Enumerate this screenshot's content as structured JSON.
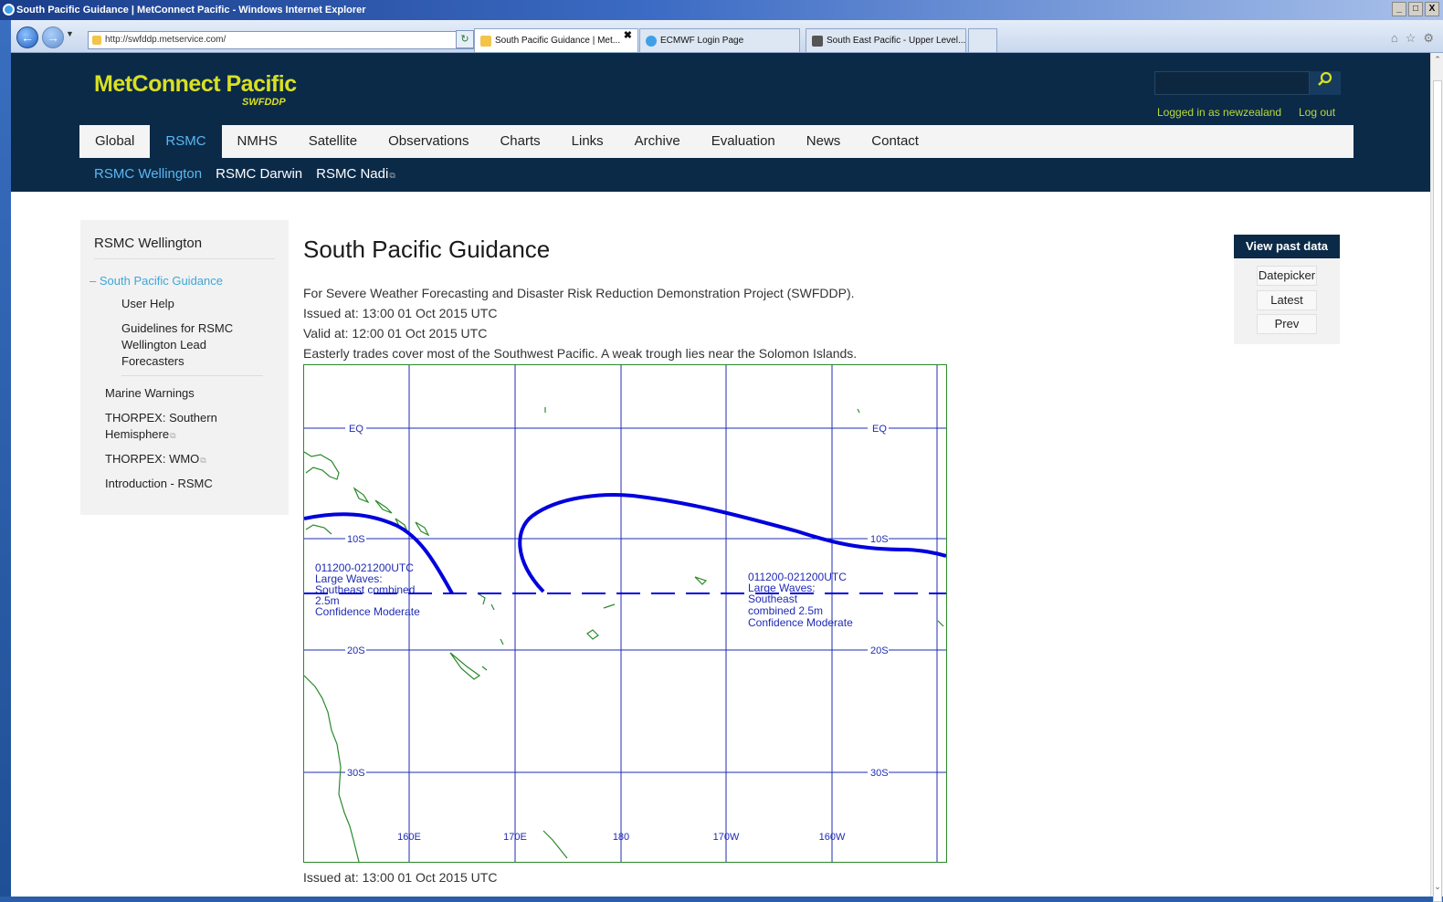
{
  "window": {
    "title": "South Pacific Guidance | MetConnect Pacific - Windows Internet Explorer",
    "controls": [
      "_",
      "□",
      "X"
    ]
  },
  "browser": {
    "address": "http://swfddp.metservice.com/",
    "tabs": [
      {
        "label": "South Pacific Guidance | Met...",
        "active": true,
        "icon_color": "#f3c44a"
      },
      {
        "label": "ECMWF Login Page",
        "active": false,
        "icon_color": "#3fa0e8"
      },
      {
        "label": "South East Pacific - Upper Level...",
        "active": false,
        "icon_color": "#555555"
      }
    ],
    "tab_close": "✖"
  },
  "site": {
    "logo": "MetConnect Pacific",
    "logo_sub": "SWFDDP",
    "search_icon": "search-icon",
    "logged_in": "Logged in as newzealand",
    "logout": "Log out",
    "brand_color": "#0b2a48",
    "accent_color": "#d9e021"
  },
  "nav": {
    "items": [
      "Global",
      "RSMC",
      "NMHS",
      "Satellite",
      "Observations",
      "Charts",
      "Links",
      "Archive",
      "Evaluation",
      "News",
      "Contact"
    ],
    "active": "RSMC"
  },
  "subnav": {
    "items": [
      "RSMC Wellington",
      "RSMC Darwin",
      "RSMC Nadi"
    ],
    "active": "RSMC Wellington"
  },
  "sidebar": {
    "title": "RSMC Wellington",
    "current": "South Pacific Guidance",
    "current_marker": "–",
    "sub_items": [
      "User Help",
      "Guidelines for RSMC",
      "Wellington Lead",
      "Forecasters"
    ],
    "links": [
      "Marine Warnings",
      "THORPEX: Southern",
      "Hemisphere",
      "THORPEX: WMO",
      "Introduction - RSMC"
    ]
  },
  "main": {
    "title": "South Pacific Guidance",
    "desc": "For Severe Weather Forecasting and Disaster Risk Reduction Demonstration Project (SWFDDP).",
    "issued": "Issued at: 13:00 01 Oct 2015 UTC",
    "valid": "Valid at: 12:00 01 Oct 2015 UTC",
    "summary": "Easterly trades cover most of the Southwest Pacific. A weak trough lies near the Solomon Islands.",
    "footer_issued": "Issued at: 13:00 01 Oct 2015 UTC"
  },
  "past_data": {
    "header": "View past data",
    "buttons": [
      "Datepicker",
      "Latest",
      "Prev"
    ]
  },
  "map": {
    "lat_labels": [
      "EQ",
      "10S",
      "20S",
      "30S"
    ],
    "lon_labels": [
      "160E",
      "170E",
      "180",
      "170W",
      "160W"
    ],
    "annotations": [
      [
        "011200-021200UTC",
        "Large Waves:",
        "Southeast combined",
        "2.5m",
        "Confidence Moderate"
      ],
      [
        "011200-021200UTC",
        "Large Waves:",
        "Southeast",
        "combined 2.5m",
        "Confidence Moderate"
      ]
    ],
    "line_color": "#0000dd",
    "grid_color": "#1f2bb3",
    "coast_color": "#2a8a2a"
  }
}
